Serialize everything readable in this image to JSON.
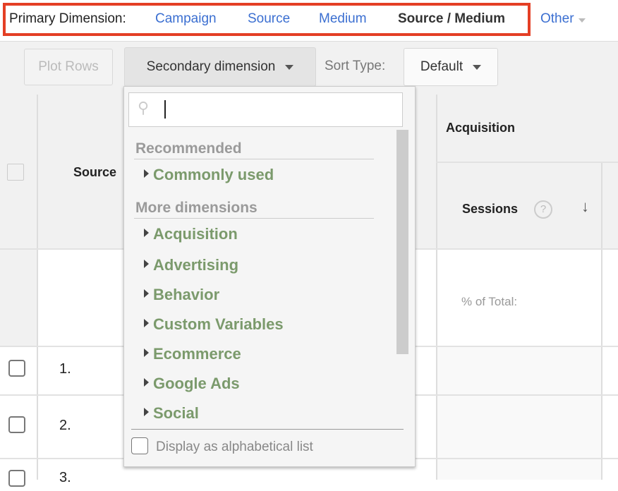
{
  "primary_dimension": {
    "label": "Primary Dimension:",
    "options": [
      "Campaign",
      "Source",
      "Medium"
    ],
    "selected": "Source / Medium",
    "other": "Other"
  },
  "toolbar": {
    "plot_rows": "Plot Rows",
    "secondary_dimension": "Secondary dimension",
    "sort_type_label": "Sort Type:",
    "sort_type_value": "Default"
  },
  "table": {
    "source_header": "Source",
    "group_header": "Acquisition",
    "sessions_header": "Sessions",
    "help": "?",
    "pct_of_total": "% of Total:",
    "rows": [
      "1.",
      "2.",
      "3."
    ]
  },
  "dropdown": {
    "search_value": "",
    "recommended": "Recommended",
    "commonly_used": "Commonly used",
    "more_dimensions": "More dimensions",
    "items": [
      "Acquisition",
      "Advertising",
      "Behavior",
      "Custom Variables",
      "Ecommerce",
      "Google Ads",
      "Social"
    ],
    "alphabetical": "Display as alphabetical list"
  },
  "colors": {
    "highlight_border": "#e43f25",
    "link": "#3b6fd1",
    "dimension_item": "#7b9a6c"
  }
}
